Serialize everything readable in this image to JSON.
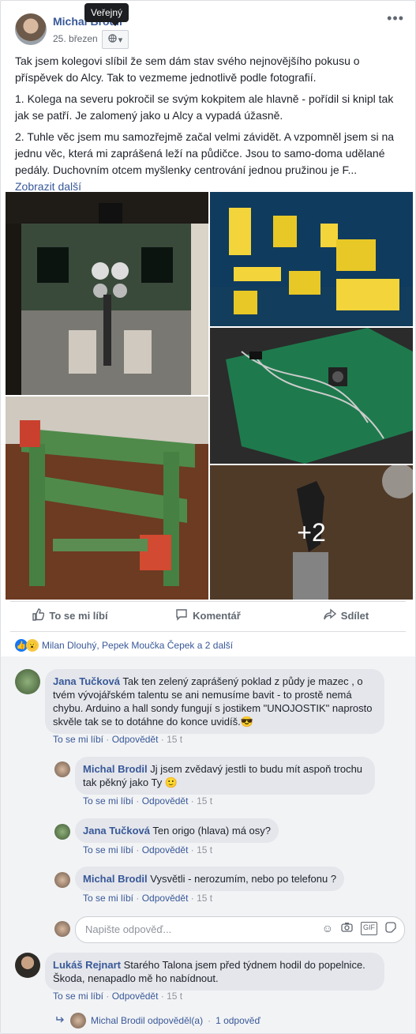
{
  "post": {
    "author": "Michal Brodil",
    "date": "25. březen",
    "privacy_tooltip": "Veřejný",
    "paragraphs": [
      "Tak jsem kolegovi slíbil že sem dám stav svého nejnovějšího pokusu o příspěvek do Alcy. Tak to vezmeme jednotlivě podle fotografií.",
      "1. Kolega na severu pokročil se svým kokpitem ale hlavně - pořídil si knipl tak jak se patří. Je zalomený jako u Alcy a vypadá úžasně.",
      "2. Tuhle věc jsem mu samozřejmě začal velmi závidět. A vzpomněl jsem si na jednu věc, která mi zaprášená leží na půdičce. Jsou to samo-doma udělané pedály. Duchovním otcem myšlenky centrování jednou pružinou je F..."
    ],
    "see_more": "Zobrazit další",
    "photos_more": "+2",
    "actions": {
      "like": "To se mi líbí",
      "comment": "Komentář",
      "share": "Sdílet"
    },
    "reactions_text": "Milan Dlouhý, Pepek Moučka Čepek a 2 další"
  },
  "comment_meta": {
    "like": "To se mi líbí",
    "reply": "Odpovědět",
    "sep": "·"
  },
  "comments": [
    {
      "author": "Jana Tučková",
      "text": "Tak ten zelený zaprášený poklad z půdy je mazec , o tvém vývojářském talentu se ani nemusíme bavit - to prostě nemá chybu. Arduino a hall sondy fungují s jostikem \"UNOJOSTIK\" naprosto skvěle tak se to dotáhne do konce uvidíš.😎",
      "time": "15 t"
    },
    {
      "author": "Michal Brodil",
      "text": "Jj jsem zvědavý jestli to budu mít aspoň trochu tak pěkný jako Ty 🙂",
      "time": "15 t"
    },
    {
      "author": "Jana Tučková",
      "text": "Ten origo (hlava) má osy?",
      "time": "15 t"
    },
    {
      "author": "Michal Brodil",
      "text": "Vysvětli - nerozumím, nebo po telefonu ?",
      "time": "15 t"
    },
    {
      "author": "Lukáš Rejnart",
      "text": "Starého Talona jsem před týdnem hodil do popelnice. Škoda, nenapadlo mě ho nabídnout.",
      "time": "15 t"
    }
  ],
  "reply_box": {
    "placeholder": "Napište odpověď..."
  },
  "replies_summary": {
    "text": "Michal Brodil odpověděl(a)",
    "sep": "·",
    "count": "1 odpověď"
  }
}
